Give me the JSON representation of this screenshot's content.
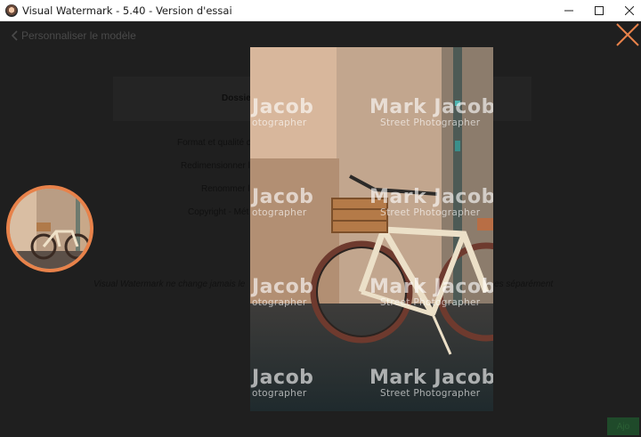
{
  "window": {
    "title": "Visual Watermark - 5.40 - Version d'essai"
  },
  "page": {
    "back_label": "Personnaliser le modèle",
    "panel_title": "Dossier",
    "menu": [
      "Format et qualité d",
      "Redimensionner l",
      "Renommer l",
      "Copyright - Mét"
    ],
    "notice_left": "Visual Watermark ne change jamais le",
    "notice_right": "es séparément",
    "next_label": "Ajo"
  },
  "watermark": {
    "name": "Mark Jacob",
    "name_partial": "Jacob",
    "subtitle": "Street Photographer",
    "subtitle_partial": "otographer"
  },
  "colors": {
    "accent": "#e8824a",
    "overlay": "#1c1c1c"
  },
  "icons": {
    "app": "visual-watermark-icon",
    "back": "chevron-left-icon",
    "minimize": "minimize-icon",
    "maximize": "maximize-icon",
    "close": "close-icon",
    "preview_close": "close-icon"
  }
}
